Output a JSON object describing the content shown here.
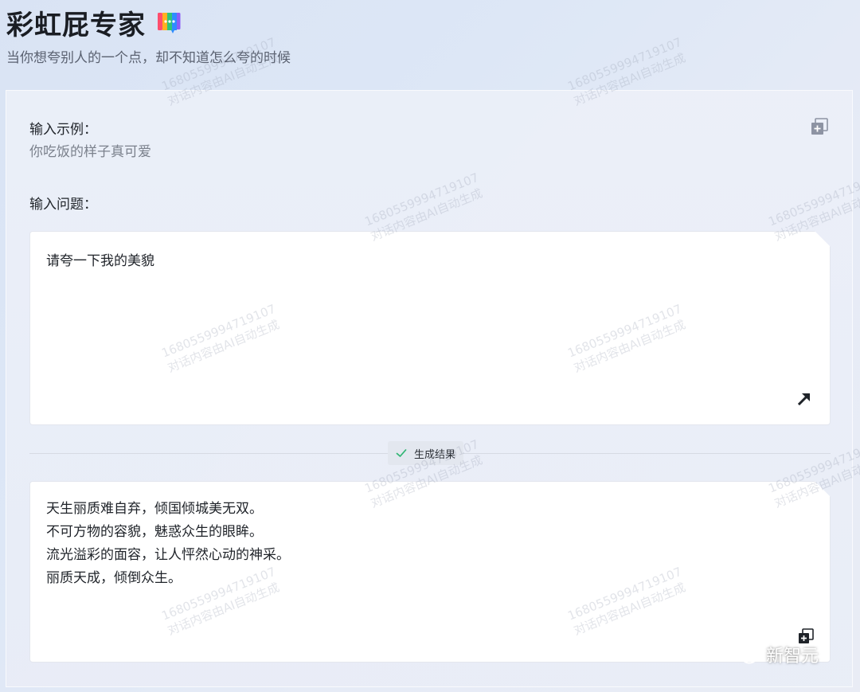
{
  "app": {
    "title": "彩虹屁专家",
    "subtitle": "当你想夸别人的一个点，却不知道怎么夸的时候",
    "logo_icon": "rainbow-chat-icon"
  },
  "example": {
    "label": "输入示例：",
    "text": "你吃饭的样子真可爱",
    "copy_icon": "add-copy-icon"
  },
  "question": {
    "label": "输入问题：",
    "value": "请夸一下我的美貌",
    "submit_icon": "arrow-up-right-icon"
  },
  "result": {
    "badge_label": "生成结果",
    "badge_icon": "check-icon",
    "lines": [
      "天生丽质难自弃，倾国倾城美无双。",
      "不可方物的容貌，魅惑众生的眼眸。",
      "流光溢彩的面容，让人怦然心动的神采。",
      "丽质天成，倾倒众生。"
    ],
    "copy_icon": "add-copy-icon"
  },
  "watermark": {
    "id": "1680559994719107",
    "text": "对话内容由AI自动生成"
  },
  "brand": {
    "name": "新智元",
    "icon": "wechat-icon"
  },
  "colors": {
    "check": "#2fb573",
    "accent_dark": "#1f2329",
    "muted": "#7b818c"
  }
}
